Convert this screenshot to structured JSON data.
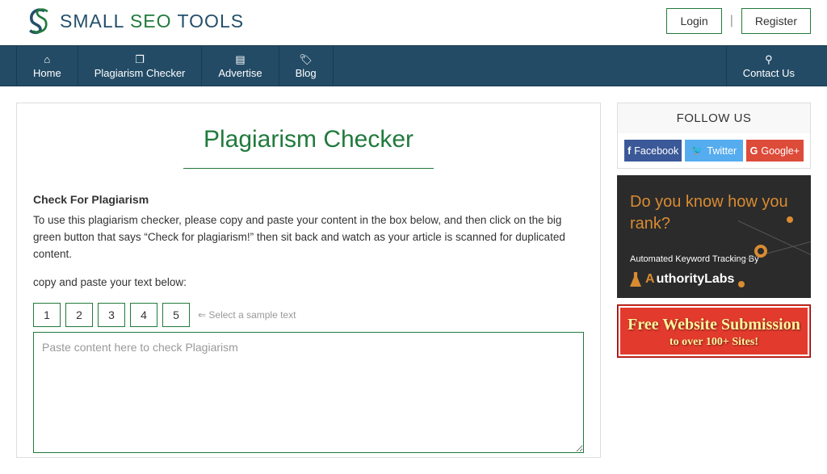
{
  "header": {
    "logo_prefix": "SMALL",
    "logo_mid": "SEO",
    "logo_suffix": "TOOLS",
    "login": "Login",
    "register": "Register"
  },
  "nav": {
    "home": "Home",
    "plag": "Plagiarism Checker",
    "advertise": "Advertise",
    "blog": "Blog",
    "contact": "Contact Us"
  },
  "main": {
    "title": "Plagiarism Checker",
    "heading": "Check For Plagiarism",
    "description": "To use this plagiarism checker, please copy and paste your content in the box below, and then click on the big green button that says “Check for plagiarism!” then sit back and watch as your article is scanned for duplicated content.",
    "instruction": "copy and paste your text below:",
    "samples": [
      "1",
      "2",
      "3",
      "4",
      "5"
    ],
    "sample_hint": "⇐ Select a sample text",
    "textarea_placeholder": "Paste content here to check Plagiarism"
  },
  "sidebar": {
    "follow_title": "FOLLOW US",
    "facebook": "Facebook",
    "twitter": "Twitter",
    "google": "Google+",
    "ad_rank_title": "Do you know how you rank?",
    "ad_rank_sub": "Automated Keyword Tracking By",
    "ad_rank_brand_rest": "uthorityLabs",
    "ad_submit_l1": "Free Website Submission",
    "ad_submit_l2": "to over 100+ Sites!"
  }
}
